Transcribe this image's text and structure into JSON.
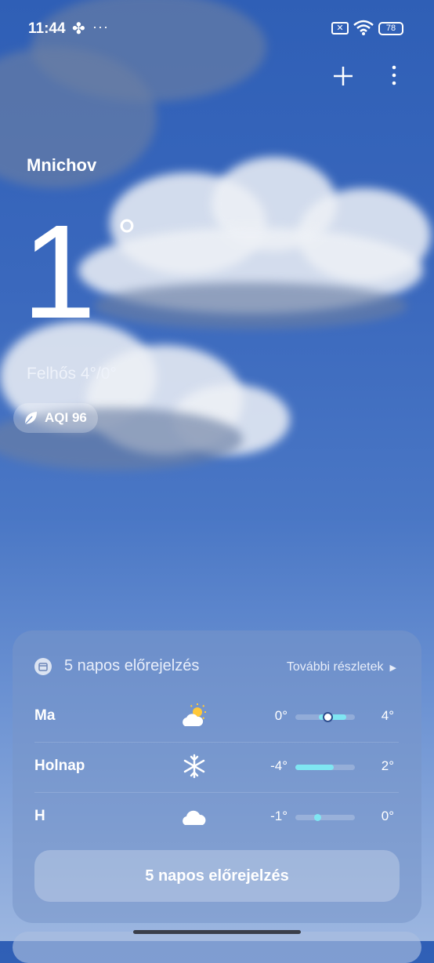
{
  "status_bar": {
    "time": "11:44",
    "dots": "···",
    "sim": "✕",
    "battery": "78"
  },
  "location": {
    "city": "Mnichov"
  },
  "current": {
    "temperature": "1",
    "degree": "°",
    "condition": "Felhős  4°/0°"
  },
  "aqi": {
    "label": "AQI 96"
  },
  "forecast": {
    "title": "5 napos előrejelzés",
    "more_label": "További részletek",
    "days": [
      {
        "day": "Ma",
        "icon": "partly-sunny-icon",
        "low": "0°",
        "high": "4°",
        "range_start": 0.4,
        "range_end": 0.85,
        "dot_pos": 0.55
      },
      {
        "day": "Holnap",
        "icon": "snowflake-icon",
        "low": "-4°",
        "high": "2°",
        "range_start": 0.0,
        "range_end": 0.65,
        "dot_pos": null
      },
      {
        "day": "H",
        "icon": "cloud-icon",
        "low": "-1°",
        "high": "0°",
        "range_start": 0.35,
        "range_end": 0.42,
        "dot_pos": 0.38
      }
    ],
    "button_label": "5 napos előrejelzés"
  },
  "colors": {
    "accent_cyan": "#7fe6f2",
    "background_top": "#2f5fb6",
    "background_bottom": "#9cb6e0"
  }
}
